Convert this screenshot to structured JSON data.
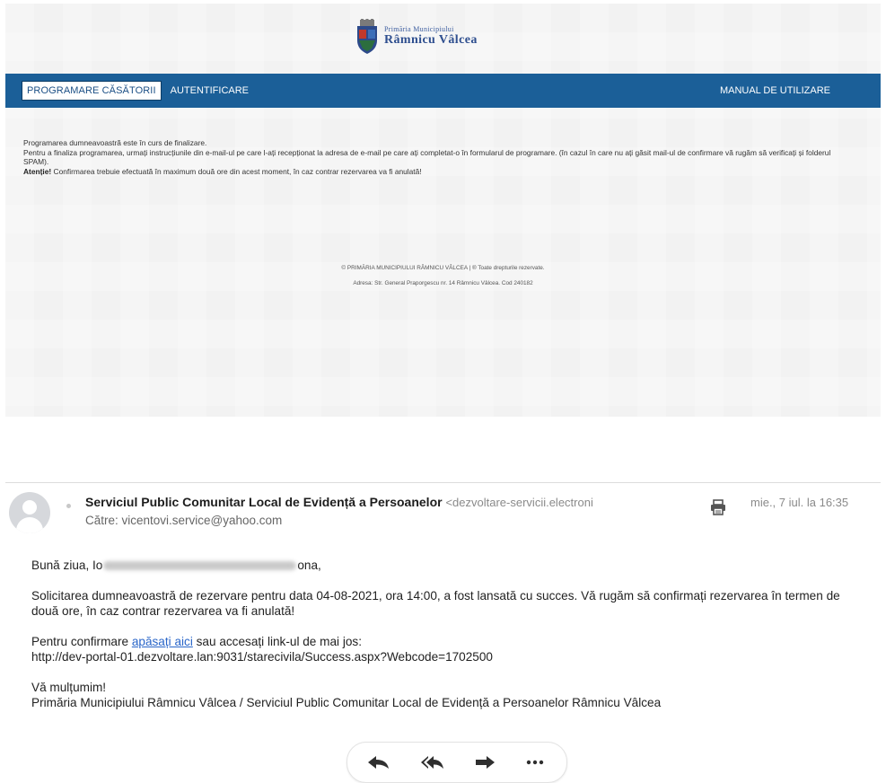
{
  "site": {
    "logo": {
      "line1": "Primăria Municipiului",
      "line2": "Râmnicu Vâlcea"
    },
    "nav": {
      "active_tab": "PROGRAMARE CĂSĂTORII",
      "login": "AUTENTIFICARE",
      "manual": "MANUAL DE UTILIZARE"
    },
    "message": {
      "line1": "Programarea dumneavoastră este în curs de finalizare.",
      "line2": "Pentru a finaliza programarea, urmați instrucțiunile din e-mail-ul pe care l-ați recepționat la adresa de e-mail pe care ați completat-o în formularul de programare. (în cazul în care nu ați găsit mail-ul de confirmare vă rugăm să verificați și folderul SPAM).",
      "attention_label": "Atenție!",
      "attention_text": " Confirmarea trebuie efectuată în maximum două ore din acest moment, în caz contrar rezervarea va fi anulată!"
    },
    "footer": {
      "copyright": "© PRIMĂRIA MUNICIPIULUI RÂMNICU VÂLCEA | ® Toate drepturile rezervate.",
      "address": "Adresa: Str. General Praporgescu nr. 14 Râmnicu Vâlcea. Cod 240182"
    }
  },
  "email": {
    "sender_name": "Serviciul Public Comunitar Local de Evidență a Persoanelor",
    "sender_address": "<dezvoltare-servicii.electroni",
    "to_label": "Către: ",
    "to_address": "vicentovi.service@yahoo.com",
    "date": "mie., 7 iul. la 16:35",
    "greeting_start": "Bună ziua, Io",
    "greeting_end": "ona,",
    "paragraph1": "Solicitarea dumneavoastră de rezervare pentru data 04-08-2021, ora 14:00, a fost lansată cu succes. Vă rugăm să confirmați rezervarea în termen de două ore, în caz contrar rezervarea va fi anulată!",
    "confirm_prefix": "Pentru confirmare ",
    "confirm_link": "apăsați aici",
    "confirm_suffix": " sau accesați link-ul de mai jos:",
    "url": "http://dev-portal-01.dezvoltare.lan:9031/starecivila/Success.aspx?Webcode=1702500",
    "thanks": "Vă mulțumim!",
    "signature": "Primăria Municipiului Râmnicu Vâlcea / Serviciul Public Comunitar Local de Evidență a Persoanelor Râmnicu Vâlcea"
  },
  "icons": {
    "avatar": "user-avatar-icon",
    "print": "print-icon",
    "reply": "reply-icon",
    "reply_all": "reply-all-icon",
    "forward": "forward-icon",
    "more": "more-icon"
  },
  "colors": {
    "navbar": "#1b5f98",
    "link": "#2a66c9",
    "icon": "#2f2f2f"
  }
}
